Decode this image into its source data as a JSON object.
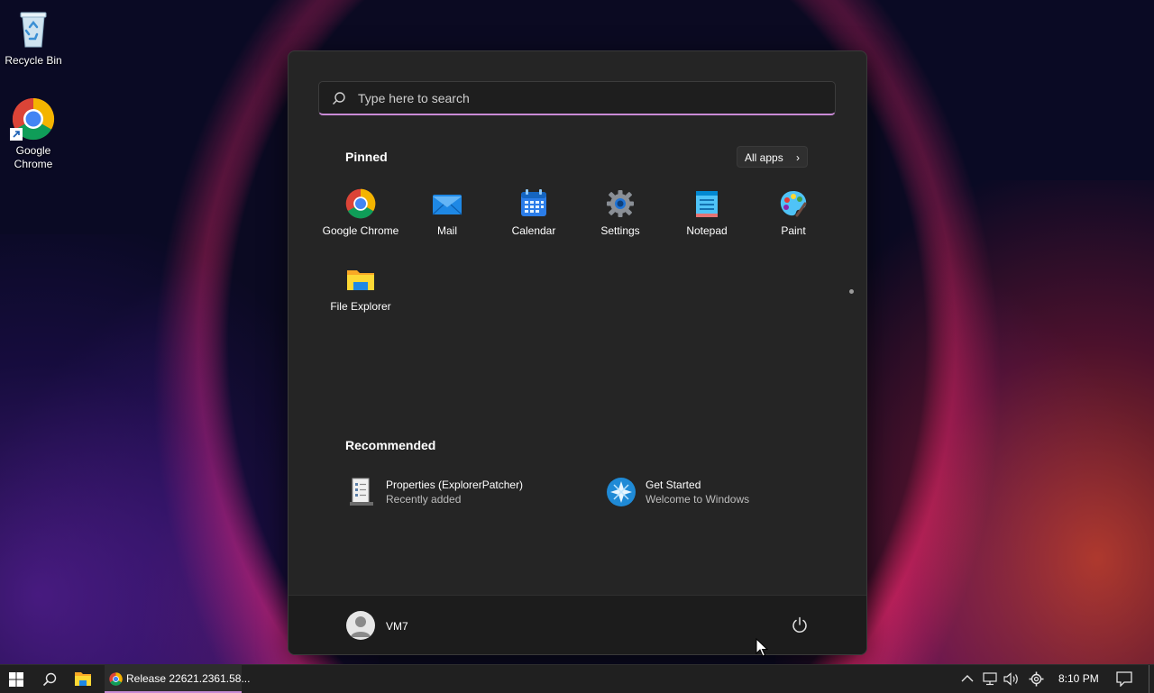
{
  "desktop": {
    "icons": [
      {
        "label": "Recycle Bin",
        "icon": "recycle-bin-icon"
      },
      {
        "label": "Google Chrome",
        "icon": "chrome-icon"
      }
    ]
  },
  "start_menu": {
    "search": {
      "placeholder": "Type here to search"
    },
    "pinned": {
      "title": "Pinned",
      "all_apps_label": "All apps",
      "apps": [
        {
          "label": "Google Chrome",
          "icon": "chrome-icon"
        },
        {
          "label": "Mail",
          "icon": "mail-icon"
        },
        {
          "label": "Calendar",
          "icon": "calendar-icon"
        },
        {
          "label": "Settings",
          "icon": "settings-gear-icon"
        },
        {
          "label": "Notepad",
          "icon": "notepad-icon"
        },
        {
          "label": "Paint",
          "icon": "paint-icon"
        },
        {
          "label": "File Explorer",
          "icon": "folder-icon"
        }
      ]
    },
    "recommended": {
      "title": "Recommended",
      "items": [
        {
          "name": "Properties (ExplorerPatcher)",
          "sub": "Recently added",
          "icon": "properties-icon"
        },
        {
          "name": "Get Started",
          "sub": "Welcome to Windows",
          "icon": "get-started-icon"
        }
      ]
    },
    "user": {
      "name": "VM7"
    }
  },
  "taskbar": {
    "task_label": "Release 22621.2361.58...",
    "clock": "8:10 PM"
  },
  "colors": {
    "accent": "#c98ad6",
    "menu_bg": "#252525",
    "taskbar_bg": "#202020"
  }
}
